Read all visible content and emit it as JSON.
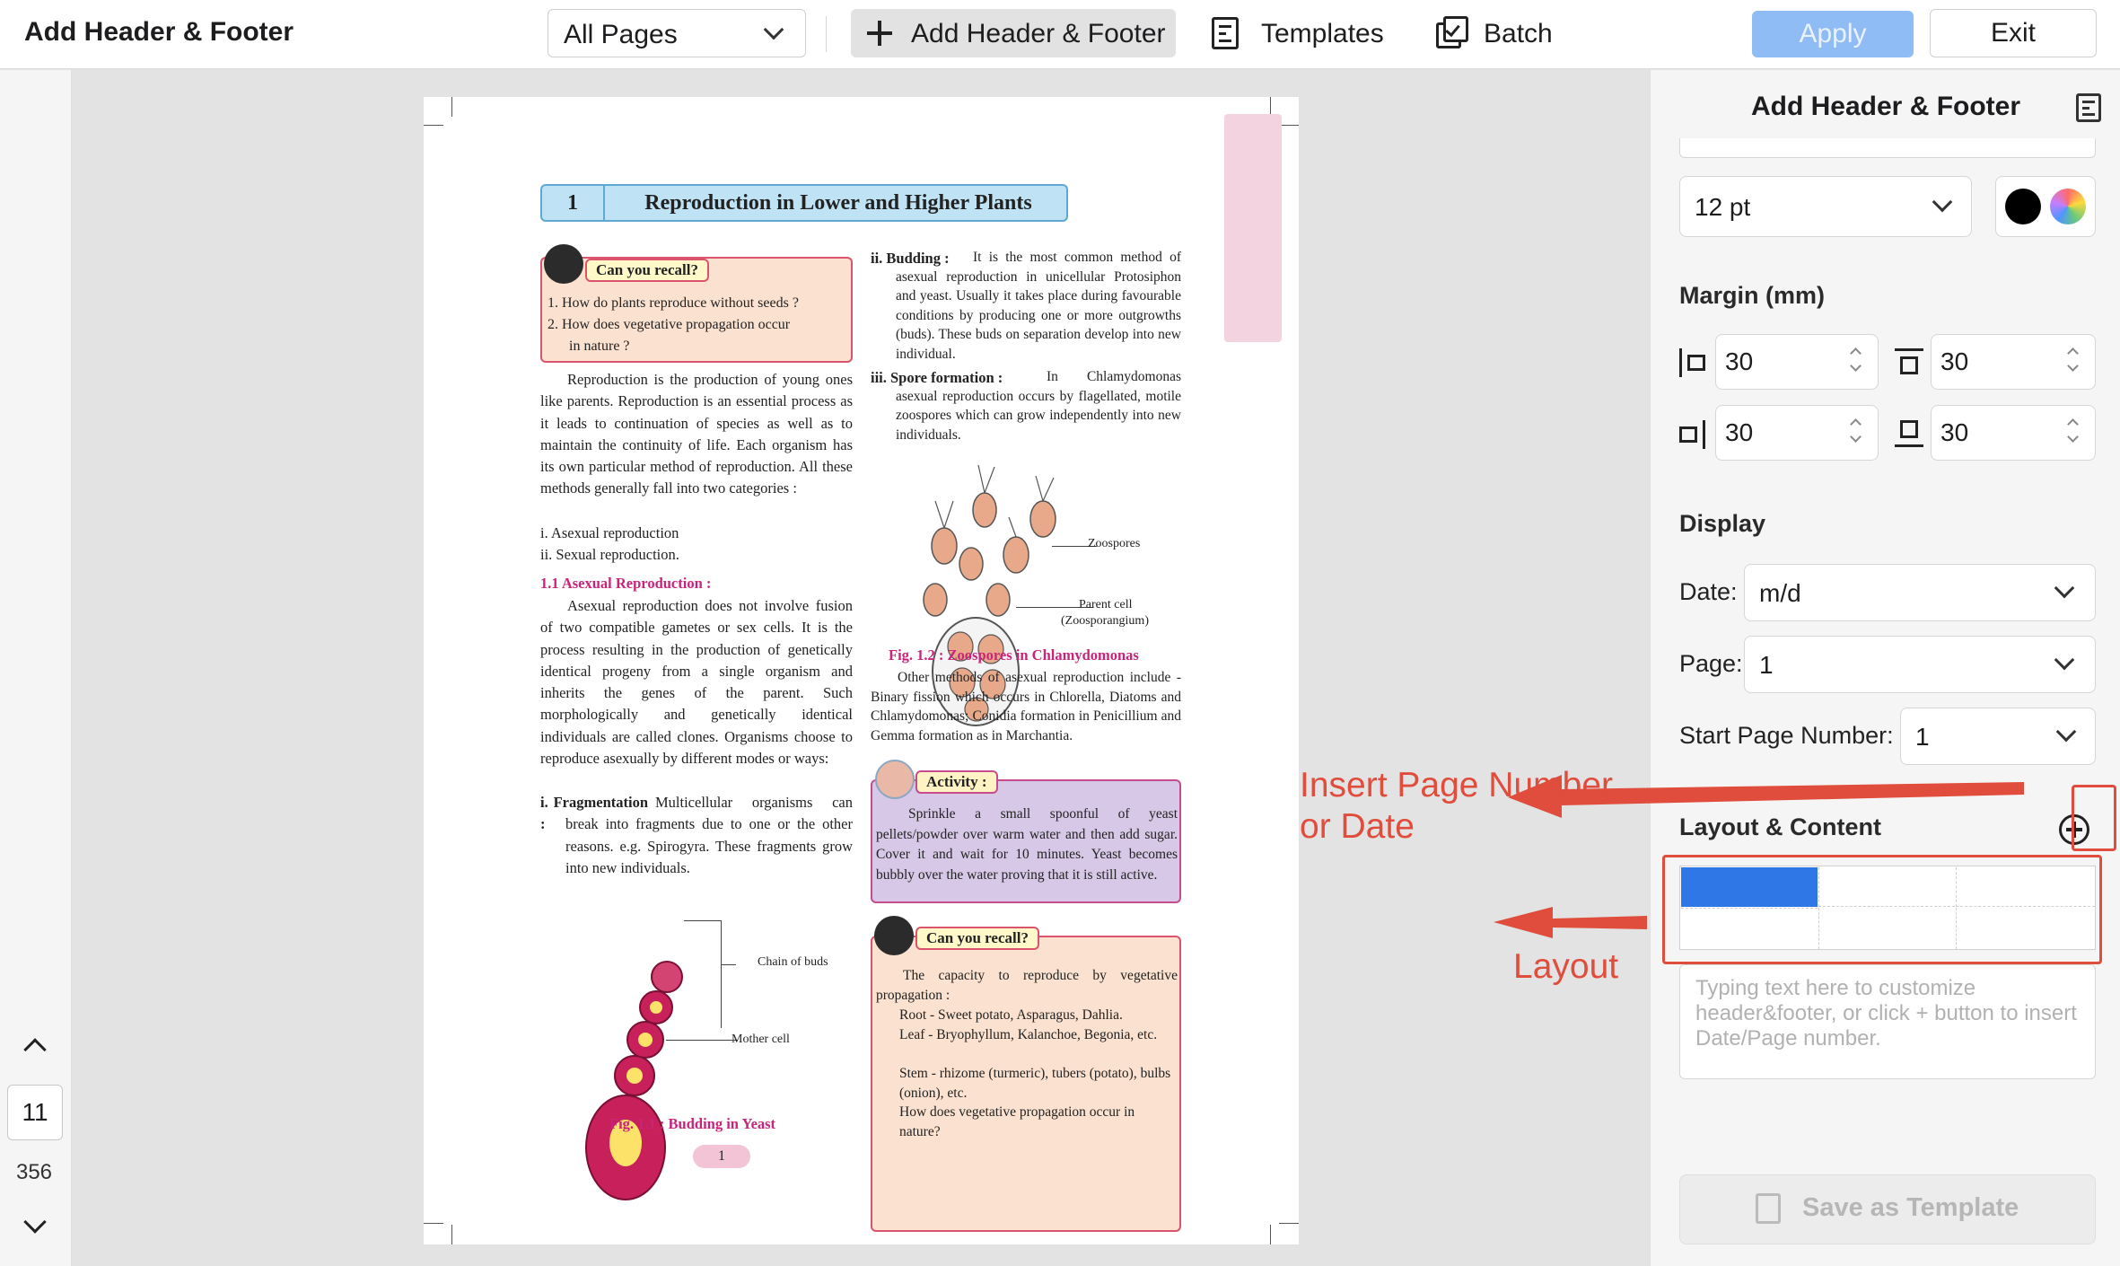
{
  "toolbar": {
    "app_title": "Add Header & Footer",
    "page_range": "All Pages",
    "add_label": "Add Header & Footer",
    "templates_label": "Templates",
    "batch_label": "Batch",
    "apply_label": "Apply",
    "exit_label": "Exit"
  },
  "navigator": {
    "current_page": "11",
    "total_pages": "356"
  },
  "document": {
    "chapter_number": "1",
    "chapter_title": "Reproduction in Lower and Higher Plants",
    "recall1_title": "Can you recall?",
    "recall1_q1": "1.  How do plants reproduce without seeds ?",
    "recall1_q2": "2.  How does vegetative propagation occur",
    "recall1_q2b": "in nature ?",
    "intro": "Reproduction is the production of young ones like parents. Reproduction is an essential process as it leads to continuation of species as well as to maintain the continuity of life. Each organism has its own particular method of reproduction. All these methods generally fall into two categories :",
    "cat1": "i. Asexual reproduction",
    "cat2": "ii. Sexual reproduction.",
    "section_title": "1.1  Asexual Reproduction :",
    "asexual_text": "Asexual reproduction does not involve fusion of two compatible gametes or sex cells. It is the process resulting in the production of genetically identical progeny from a single organism and inherits the genes of the parent. Such morphologically and genetically identical individuals are called clones. Organisms choose to reproduce asexually by different modes or ways:",
    "frag_head": "i.   Fragmentation :",
    "frag_text": "Multicellular organisms can break into fragments due to one or the other reasons. e.g. Spirogyra. These fragments grow into new individuals.",
    "fig1_label_buds": "Chain of buds",
    "fig1_label_mother": "Mother cell",
    "fig1_caption": "Fig. 1.1 : Budding in Yeast",
    "budding_head": "ii.   Budding :",
    "budding_text": "It is the most common method of asexual reproduction in unicellular Protosiphon and yeast. Usually it takes place during favourable conditions by producing one or more outgrowths (buds). These buds on separation develop into new individual.",
    "spore_head": "iii.  Spore formation :",
    "spore_text": "In Chlamydomonas asexual reproduction occurs by flagellated, motile zoospores which can grow independently into new individuals.",
    "fig2_label_zoo": "Zoospores",
    "fig2_label_parent": "Parent cell",
    "fig2_label_parent2": "(Zoosporangium)",
    "fig2_caption": "Fig. 1.2 : Zoospores in Chlamydomonas",
    "other_methods": "Other methods of asexual reproduction include - Binary fission which occurs in Chlorella, Diatoms and Chlamydomonas; Conidia formation in Penicillium and Gemma formation as in Marchantia.",
    "activity_title": "Activity :",
    "activity_text": "Sprinkle a small spoonful of yeast pellets/powder over warm water and then add sugar. Cover it and wait for 10 minutes. Yeast becomes bubbly over the water proving that it is still active.",
    "recall2_title": "Can you recall?",
    "recall2_intro": "The capacity to reproduce by vegetative propagation :",
    "recall2_b1": "Root - Sweet potato, Asparagus, Dahlia.",
    "recall2_b2": "Leaf - Bryophyllum, Kalanchoe, Begonia, etc.",
    "recall2_b3": "Stem - rhizome (turmeric), tubers (potato), bulbs (onion), etc.",
    "recall2_b4": "How does vegetative propagation occur in nature?",
    "page_number": "1"
  },
  "panel": {
    "title": "Add Header & Footer",
    "font_size": "12 pt",
    "colors": {
      "text": "#000000",
      "accent": "#2f76e6"
    },
    "margin_label": "Margin (mm)",
    "margin_left": "30",
    "margin_top": "30",
    "margin_right": "30",
    "margin_bottom": "30",
    "display_label": "Display",
    "date_label": "Date:",
    "date_value": "m/d",
    "page_label": "Page:",
    "page_value": "1",
    "start_label": "Start Page Number:",
    "start_value": "1",
    "layout_label": "Layout & Content",
    "text_placeholder": "Typing text here to customize header&footer, or click + button to insert Date/Page number.",
    "save_template": "Save as Template"
  },
  "annotations": {
    "insert_line1": "Insert Page Number",
    "insert_line2": "or Date",
    "layout": "Layout"
  }
}
